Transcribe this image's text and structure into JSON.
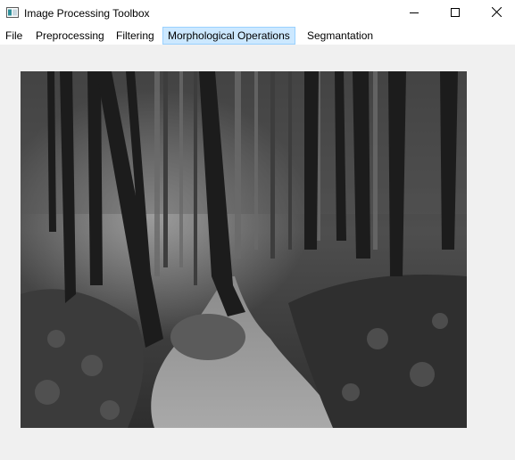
{
  "window": {
    "title": "Image Processing Toolbox",
    "controls": {
      "minimize_icon": "minimize-icon",
      "maximize_icon": "maximize-icon",
      "close_icon": "close-icon"
    }
  },
  "menubar": {
    "items": [
      {
        "label": "File",
        "active": false
      },
      {
        "label": "Preprocessing",
        "active": false
      },
      {
        "label": "Filtering",
        "active": false
      },
      {
        "label": "Morphological Operations",
        "active": true
      },
      {
        "label": "Segmantation",
        "active": false
      }
    ],
    "highlight_color": "#cce8ff"
  },
  "image": {
    "description_type": "grayscale-photo",
    "subject_icon": "forest-path-photo"
  }
}
